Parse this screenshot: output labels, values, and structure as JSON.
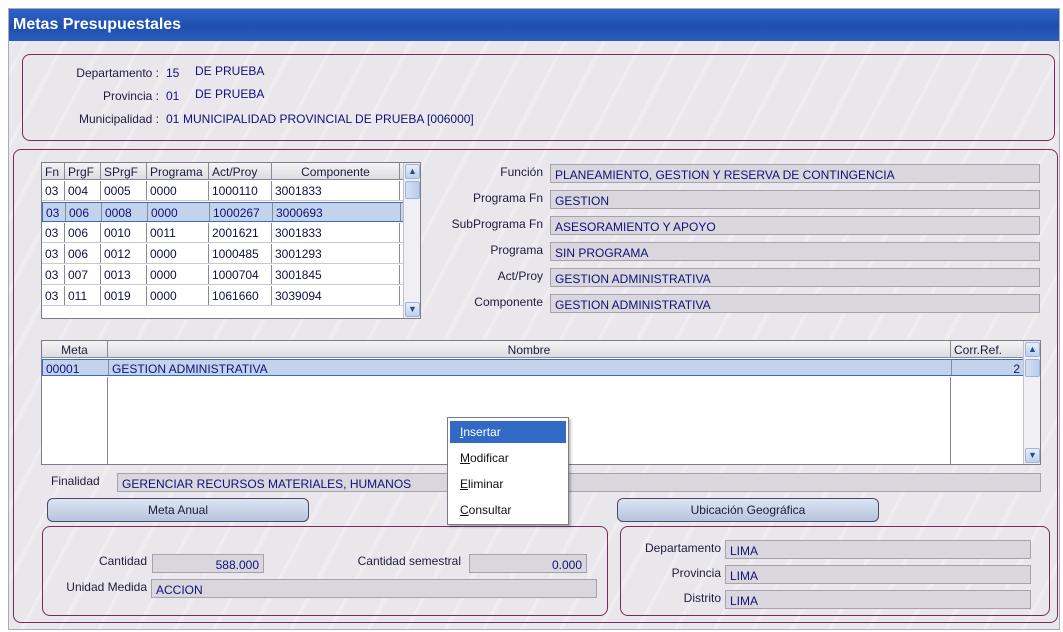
{
  "window": {
    "title": "Metas Presupuestales"
  },
  "header": {
    "departamento_label": "Departamento :",
    "departamento_code": "15",
    "departamento_name": "DE PRUEBA",
    "provincia_label": "Provincia :",
    "provincia_code": "01",
    "provincia_name": "DE PRUEBA",
    "municipalidad_label": "Municipalidad :",
    "municipalidad_code": "01",
    "municipalidad_name": "MUNICIPALIDAD PROVINCIAL DE PRUEBA [006000]"
  },
  "func_grid": {
    "columns": [
      "Fn",
      "PrgF",
      "SPrgF",
      "Programa",
      "Act/Proy",
      "Componente"
    ],
    "rows": [
      [
        "03",
        "004",
        "0005",
        "0000",
        "1000110",
        "3001833"
      ],
      [
        "03",
        "006",
        "0008",
        "0000",
        "1000267",
        "3000693"
      ],
      [
        "03",
        "006",
        "0010",
        "0011",
        "2001621",
        "3001833"
      ],
      [
        "03",
        "006",
        "0012",
        "0000",
        "1000485",
        "3001293"
      ],
      [
        "03",
        "007",
        "0013",
        "0000",
        "1000704",
        "3001845"
      ],
      [
        "03",
        "011",
        "0019",
        "0000",
        "1061660",
        "3039094"
      ]
    ],
    "selected_index": 1
  },
  "details": {
    "funcion_label": "Función",
    "funcion_value": "PLANEAMIENTO, GESTION Y RESERVA DE CONTINGENCIA",
    "programa_fn_label": "Programa Fn",
    "programa_fn_value": "GESTION",
    "subprograma_fn_label": "SubPrograma Fn",
    "subprograma_fn_value": "ASESORAMIENTO Y APOYO",
    "programa_label": "Programa",
    "programa_value": "SIN PROGRAMA",
    "actproy_label": "Act/Proy",
    "actproy_value": "GESTION ADMINISTRATIVA",
    "componente_label": "Componente",
    "componente_value": "GESTION ADMINISTRATIVA"
  },
  "meta_grid": {
    "columns": [
      "Meta",
      "Nombre",
      "Corr.Ref."
    ],
    "rows": [
      {
        "meta": "00001",
        "nombre": "GESTION ADMINISTRATIVA",
        "corr": "2"
      }
    ]
  },
  "finalidad": {
    "label": "Finalidad",
    "value": "GERENCIAR RECURSOS MATERIALES, HUMANOS"
  },
  "buttons": {
    "meta_anual": "Meta Anual",
    "ubicacion": "Ubicación Geográfica"
  },
  "meta_anual": {
    "cantidad_label": "Cantidad",
    "cantidad_value": "588.000",
    "cantidad_semestral_label": "Cantidad semestral",
    "cantidad_semestral_value": "0.000",
    "unidad_medida_label": "Unidad Medida",
    "unidad_medida_value": "ACCION"
  },
  "ubicacion": {
    "departamento_label": "Departamento",
    "departamento_value": "LIMA",
    "provincia_label": "Provincia",
    "provincia_value": "LIMA",
    "distrito_label": "Distrito",
    "distrito_value": "LIMA"
  },
  "context_menu": {
    "items": [
      {
        "first": "I",
        "rest": "nsertar"
      },
      {
        "first": "M",
        "rest": "odificar"
      },
      {
        "first": "E",
        "rest": "liminar"
      },
      {
        "first": "C",
        "rest": "onsultar"
      }
    ],
    "highlighted_index": 0
  },
  "icons": {
    "scroll_up": "chevron-up-icon",
    "scroll_down": "chevron-down-icon"
  }
}
